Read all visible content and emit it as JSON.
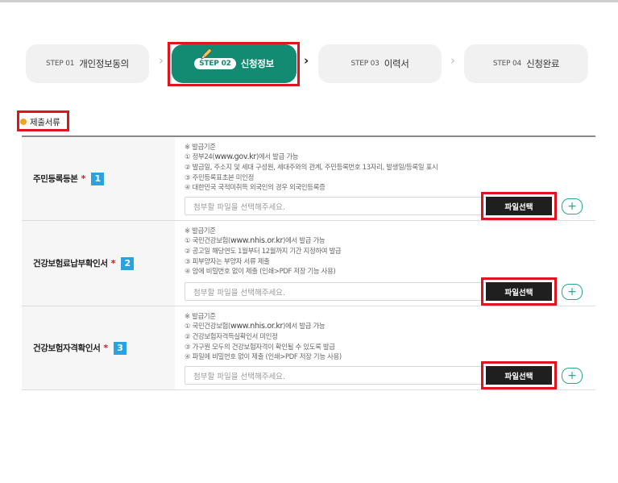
{
  "steps": [
    {
      "num": "STEP 01",
      "label": "개인정보동의"
    },
    {
      "num": "STEP 02",
      "label": "신청정보"
    },
    {
      "num": "STEP 03",
      "label": "이력서"
    },
    {
      "num": "STEP 04",
      "label": "신청완료"
    }
  ],
  "step_arrows": [
    "›",
    "›",
    "›"
  ],
  "section_title": "제출서류",
  "rows": [
    {
      "name": "주민등록등본",
      "required_mark": "*",
      "badge": "1",
      "info_lines": [
        "※ 발급기준",
        "① 정부24(",
        "② 발급일, 주소지 및 세대 구성원, 세대주와의 관계, 주민등록번호 13자리, 발생일/등록일 표시",
        "③ 주민등록표초본 미인정",
        "④ 대한민국 국적미취득 외국인의 경우 외국인등록증"
      ],
      "url": "www.gov.kr",
      "url_suffix": ")에서 발급 가능",
      "placeholder": "첨부할 파일을 선택해주세요.",
      "file_button": "파일선택",
      "add_button": "+"
    },
    {
      "name": "건강보험료납부확인서",
      "required_mark": "*",
      "badge": "2",
      "info_lines": [
        "※ 발급기준",
        "① 국민건강보험(",
        "② 공고일 해당연도 1월부터 12월까지 기간 지정하여 발급",
        "③ 피부양자는 부양자 서류 제출",
        "④ 암에 비밀번호 없이 제출 (인쇄>PDF 저장 기능 사용)"
      ],
      "url": "www.nhis.or.kr",
      "url_suffix": ")에서 발급 가능",
      "placeholder": "첨부할 파일을 선택해주세요.",
      "file_button": "파일선택",
      "add_button": "+"
    },
    {
      "name": "건강보험자격확인서",
      "required_mark": "*",
      "badge": "3",
      "info_lines": [
        "※ 발급기준",
        "① 국민건강보험(",
        "② 건강보험자격득실확인서 미인정",
        "③ 가구원 모두의 건강보험자격이 확인될 수 있도록 발급",
        "④ 파일에 비밀번호 없이 제출 (인쇄>PDF 저장 기능 사용)"
      ],
      "url": "www.nhis.or.kr",
      "url_suffix": ")에서 발급 가능",
      "placeholder": "첨부할 파일을 선택해주세요.",
      "file_button": "파일선택",
      "add_button": "+"
    }
  ],
  "colors": {
    "accent": "#138a72",
    "highlight": "#e0141c",
    "badge": "#29a3e0",
    "required": "#e0141c"
  }
}
